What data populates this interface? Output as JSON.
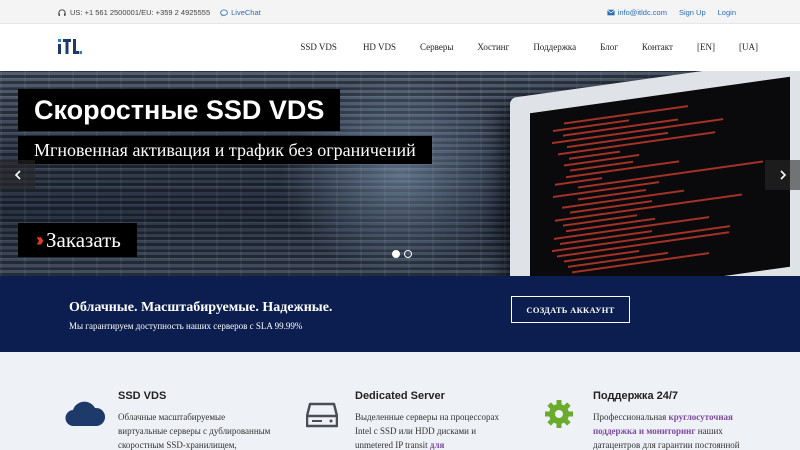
{
  "topbar": {
    "phones": "US: +1 561 2500001/EU: +359 2 4925555",
    "livechat": "LiveChat",
    "email": "info@itldc.com",
    "signup": "Sign Up",
    "login": "Login"
  },
  "logo": {
    "text": "ITL"
  },
  "nav": {
    "items": [
      "SSD VDS",
      "HD VDS",
      "Серверы",
      "Хостинг",
      "Поддержка",
      "Блог",
      "Контакт",
      "[EN]",
      "[UA]"
    ]
  },
  "hero": {
    "title": "Скоростные SSD VDS",
    "subtitle": "Мгновенная активация и трафик без ограничений",
    "order": "Заказать",
    "prev_icon": "chevron-left-icon",
    "next_icon": "chevron-right-icon",
    "slides_total": 2,
    "active_slide": 1
  },
  "banner": {
    "heading": "Облачные. Масштабируемые. Надежные.",
    "text": "Мы гарантируем доступность наших серверов с SLA 99.99%",
    "button": "СОЗДАТЬ АККАУНТ"
  },
  "features": [
    {
      "icon": "cloud-icon",
      "title": "SSD VDS",
      "lines": [
        "Облачные масштабируемые",
        "виртуальные серверы с дублированным",
        "скоростным SSD-хранилищем,"
      ]
    },
    {
      "icon": "hard-drive-icon",
      "title": "Dedicated Server",
      "lines": [
        "Выделенные серверы на процессорах",
        "Intel с SSD или HDD дисками и",
        "unmetered IP transit"
      ],
      "line3_highlight": "для"
    },
    {
      "icon": "gear-icon",
      "title": "Поддержка 24/7",
      "line1_start": "Профессиональная",
      "line1_highlight": "круглосуточная",
      "line2_highlight": "поддержка и мониторинг",
      "line2_end": "наших",
      "line3": "датацентров для гарантии постоянной"
    }
  ],
  "colors": {
    "banner_bg": "#0c1e4f",
    "accent_red": "#e03a2a",
    "link_blue": "#2a6db5",
    "highlight_purple": "#7b4aa0",
    "gear_green": "#6aaa2c",
    "cloud_navy": "#1e3a6a"
  }
}
